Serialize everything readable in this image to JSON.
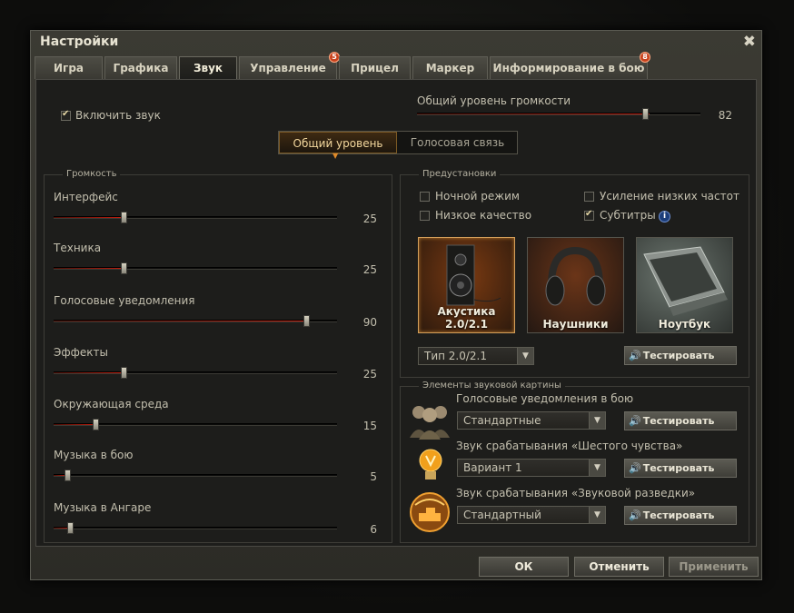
{
  "window": {
    "title": "Настройки",
    "close_glyph": "✖"
  },
  "tabs": [
    {
      "label": "Игра"
    },
    {
      "label": "Графика"
    },
    {
      "label": "Звук"
    },
    {
      "label": "Управление",
      "badge": "5"
    },
    {
      "label": "Прицел"
    },
    {
      "label": "Маркер"
    },
    {
      "label": "Информирование в бою",
      "badge": "8"
    }
  ],
  "sound": {
    "enable_label": "Включить звук",
    "enabled": true,
    "master_label": "Общий уровень громкости",
    "master_value": "82",
    "master_level": 82,
    "segments": [
      "Общий уровень",
      "Голосовая связь"
    ]
  },
  "volume": {
    "title": "Громкость",
    "sliders": [
      {
        "label": "Интерфейс",
        "value": "25",
        "level": 25
      },
      {
        "label": "Техника",
        "value": "25",
        "level": 25
      },
      {
        "label": "Голосовые уведомления",
        "value": "90",
        "level": 90
      },
      {
        "label": "Эффекты",
        "value": "25",
        "level": 25
      },
      {
        "label": "Окружающая среда",
        "value": "15",
        "level": 15
      },
      {
        "label": "Музыка в бою",
        "value": "5",
        "level": 5
      },
      {
        "label": "Музыка в Ангаре",
        "value": "6",
        "level": 6
      }
    ]
  },
  "presets": {
    "title": "Предустановки",
    "night_mode": "Ночной режим",
    "low_quality": "Низкое качество",
    "bass_boost": "Усиление низких частот",
    "subtitles": "Субтитры",
    "cards": [
      "Акустика 2.0/2.1",
      "Наушники",
      "Ноутбук"
    ],
    "type_value": "Тип 2.0/2.1",
    "test_label": "Тестировать",
    "info_glyph": "i"
  },
  "elements": {
    "title": "Элементы звуковой картины",
    "items": [
      {
        "label": "Голосовые уведомления в бою",
        "value": "Стандартные"
      },
      {
        "label": "Звук срабатывания «Шестого чувства»",
        "value": "Вариант 1"
      },
      {
        "label": "Звук срабатывания «Звуковой разведки»",
        "value": "Стандартный"
      }
    ]
  },
  "footer": {
    "ok": "ОК",
    "cancel": "Отменить",
    "apply": "Применить"
  },
  "colors": {
    "accent": "#c21d0e",
    "highlight": "#f2d79d",
    "badge": "#c7421d"
  }
}
